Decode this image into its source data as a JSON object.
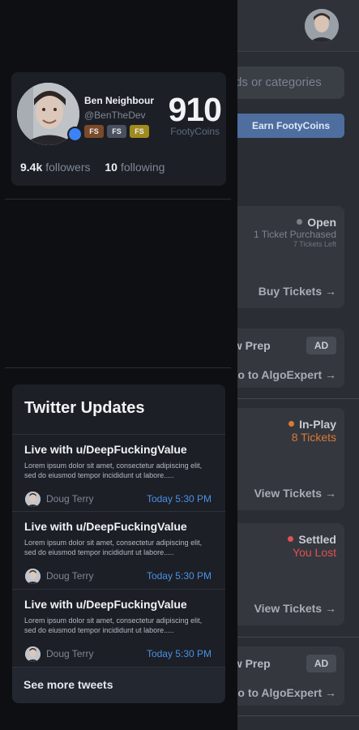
{
  "background": {
    "search_placeholder": "ds or categories",
    "earn_button": "Earn FootyCoins",
    "cards": [
      {
        "status": "Open",
        "status_color": "#7a7f88",
        "sub": "1 Ticket Purchased",
        "sub2": "7 Tickets Left",
        "action": "Buy Tickets →"
      },
      {
        "ad_title": "ew Prep",
        "ad_badge": "AD",
        "ad_action": "o to AlgoExpert →"
      },
      {
        "status": "In-Play",
        "status_color": "#d97a36",
        "sub": "8 Tickets",
        "sub_color": "#d97a36",
        "action": "View Tickets →"
      },
      {
        "status": "Settled",
        "status_color": "#e05252",
        "sub": "You Lost",
        "sub_color": "#e05252",
        "action": "View Tickets →"
      },
      {
        "ad_title": "ew Prep",
        "ad_badge": "AD",
        "ad_action": "o to AlgoExpert →"
      }
    ]
  },
  "profile": {
    "name": "Ben Neighbour",
    "handle": "@BenTheDev",
    "badges": [
      {
        "label": "FS",
        "color": "#7a4a2a"
      },
      {
        "label": "FS",
        "color": "#4a5060"
      },
      {
        "label": "FS",
        "color": "#a08a1e"
      }
    ],
    "coins": "910",
    "coins_label": "FootyCoins",
    "followers_count": "9.4k",
    "followers_label": "followers",
    "following_count": "10",
    "following_label": "following"
  },
  "twitter": {
    "title": "Twitter Updates",
    "tweets": [
      {
        "title": "Live with u/DeepFuckingValue",
        "body": "Lorem ipsum dolor sit amet, consectetur adipiscing elit, sed do eiusmod tempor incididunt ut labore.....",
        "author": "Doug Terry",
        "time": "Today 5:30 PM"
      },
      {
        "title": "Live with u/DeepFuckingValue",
        "body": "Lorem ipsum dolor sit amet, consectetur adipiscing elit, sed do eiusmod tempor incididunt ut labore.....",
        "author": "Doug Terry",
        "time": "Today 5:30 PM"
      },
      {
        "title": "Live with u/DeepFuckingValue",
        "body": "Lorem ipsum dolor sit amet, consectetur adipiscing elit, sed do eiusmod tempor incididunt ut labore.....",
        "author": "Doug Terry",
        "time": "Today 5:30 PM"
      }
    ],
    "see_more": "See more tweets"
  }
}
